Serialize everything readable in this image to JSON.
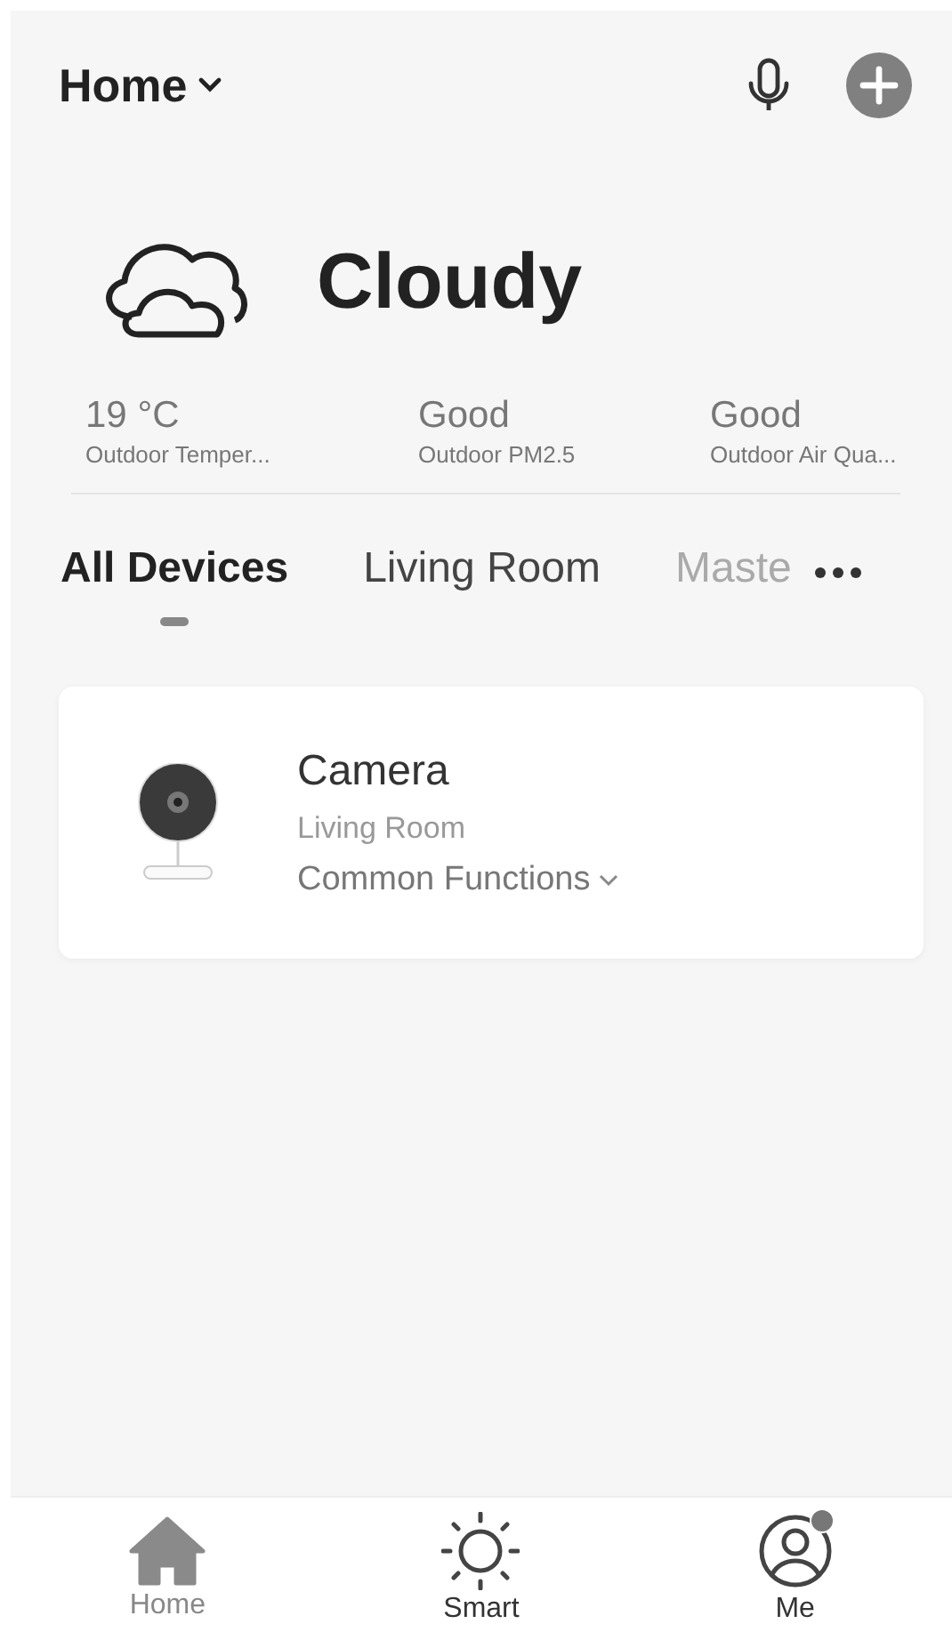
{
  "header": {
    "title": "Home"
  },
  "weather": {
    "condition": "Cloudy"
  },
  "stats": [
    {
      "value": "19 °C",
      "label": "Outdoor Temper..."
    },
    {
      "value": "Good",
      "label": "Outdoor PM2.5"
    },
    {
      "value": "Good",
      "label": "Outdoor Air Qua..."
    }
  ],
  "tabs": [
    {
      "label": "All Devices",
      "selected": true
    },
    {
      "label": "Living Room",
      "selected": false
    },
    {
      "label": "Maste",
      "selected": false
    }
  ],
  "devices": [
    {
      "name": "Camera",
      "room": "Living Room",
      "action": "Common Functions"
    }
  ],
  "nav": [
    {
      "kind": "home",
      "label": "Home",
      "selected": true,
      "badge": false
    },
    {
      "kind": "smart",
      "label": "Smart",
      "selected": false,
      "badge": false
    },
    {
      "kind": "me",
      "label": "Me",
      "selected": false,
      "badge": true
    }
  ]
}
